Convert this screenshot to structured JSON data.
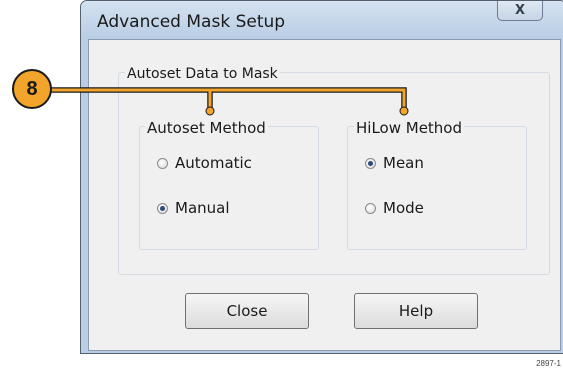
{
  "dialog": {
    "title": "Advanced Mask Setup",
    "close_glyph": "X",
    "outer_group_label": "Autoset Data to Mask",
    "autoset_method": {
      "label": "Autoset Method",
      "options": [
        {
          "label": "Automatic",
          "selected": false
        },
        {
          "label": "Manual",
          "selected": true
        }
      ]
    },
    "hilow_method": {
      "label": "HiLow Method",
      "options": [
        {
          "label": "Mean",
          "selected": true
        },
        {
          "label": "Mode",
          "selected": false
        }
      ]
    },
    "buttons": {
      "close_label": "Close",
      "help_label": "Help"
    }
  },
  "callout": {
    "number": "8",
    "color": "#f2a52a"
  },
  "figure_id": "2897-1"
}
